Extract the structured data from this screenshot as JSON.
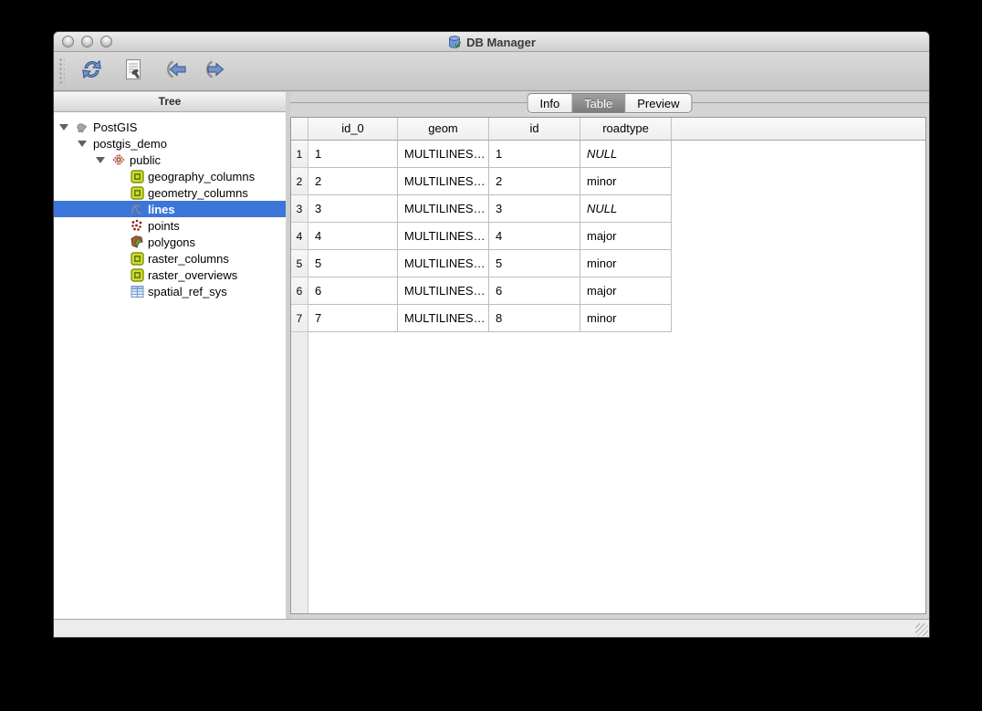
{
  "window": {
    "title": "DB Manager"
  },
  "titlebar": {
    "traffic_lights": [
      "close-button",
      "minimize-button",
      "zoom-button"
    ]
  },
  "toolbar": {
    "buttons": [
      {
        "id": "refresh",
        "icon": "refresh-icon"
      },
      {
        "id": "sql-window",
        "icon": "sql-window-icon"
      },
      {
        "id": "import-layer",
        "icon": "import-layer-icon"
      },
      {
        "id": "export-layer",
        "icon": "export-layer-icon"
      }
    ]
  },
  "sidebar": {
    "header": "Tree",
    "items": [
      {
        "label": "PostGIS",
        "level": 0,
        "expandable": true,
        "icon": "postgis-elephant-icon",
        "selected": false
      },
      {
        "label": "postgis_demo",
        "level": 1,
        "expandable": true,
        "icon": null,
        "selected": false
      },
      {
        "label": "public",
        "level": 2,
        "expandable": true,
        "icon": "schema-diamond-icon",
        "selected": false
      },
      {
        "label": "geography_columns",
        "level": 3,
        "expandable": false,
        "icon": "table-green-icon",
        "selected": false
      },
      {
        "label": "geometry_columns",
        "level": 3,
        "expandable": false,
        "icon": "table-green-icon",
        "selected": false
      },
      {
        "label": "lines",
        "level": 3,
        "expandable": false,
        "icon": "line-layer-icon",
        "selected": true
      },
      {
        "label": "points",
        "level": 3,
        "expandable": false,
        "icon": "point-layer-icon",
        "selected": false
      },
      {
        "label": "polygons",
        "level": 3,
        "expandable": false,
        "icon": "polygon-layer-icon",
        "selected": false
      },
      {
        "label": "raster_columns",
        "level": 3,
        "expandable": false,
        "icon": "table-green-icon",
        "selected": false
      },
      {
        "label": "raster_overviews",
        "level": 3,
        "expandable": false,
        "icon": "table-green-icon",
        "selected": false
      },
      {
        "label": "spatial_ref_sys",
        "level": 3,
        "expandable": false,
        "icon": "spatial-ref-table-icon",
        "selected": false
      }
    ]
  },
  "tabs": [
    {
      "label": "Info",
      "selected": false
    },
    {
      "label": "Table",
      "selected": true
    },
    {
      "label": "Preview",
      "selected": false
    }
  ],
  "table": {
    "columns": [
      "id_0",
      "geom",
      "id",
      "roadtype"
    ],
    "null_display": "NULL",
    "rows": [
      {
        "num": "1",
        "cells": [
          "1",
          "MULTILINES…",
          "1",
          "NULL"
        ]
      },
      {
        "num": "2",
        "cells": [
          "2",
          "MULTILINES…",
          "2",
          "minor"
        ]
      },
      {
        "num": "3",
        "cells": [
          "3",
          "MULTILINES…",
          "3",
          "NULL"
        ]
      },
      {
        "num": "4",
        "cells": [
          "4",
          "MULTILINES…",
          "4",
          "major"
        ]
      },
      {
        "num": "5",
        "cells": [
          "5",
          "MULTILINES…",
          "5",
          "minor"
        ]
      },
      {
        "num": "6",
        "cells": [
          "6",
          "MULTILINES…",
          "6",
          "major"
        ]
      },
      {
        "num": "7",
        "cells": [
          "7",
          "MULTILINES…",
          "8",
          "minor"
        ]
      }
    ]
  },
  "colors": {
    "selection_blue": "#3b76d8",
    "tab_selected_gray": "#8e8e8e",
    "table_icon_green": "#cddc39",
    "toolbar_icon_blue": "#7493c4",
    "null_text_style": "italic"
  }
}
